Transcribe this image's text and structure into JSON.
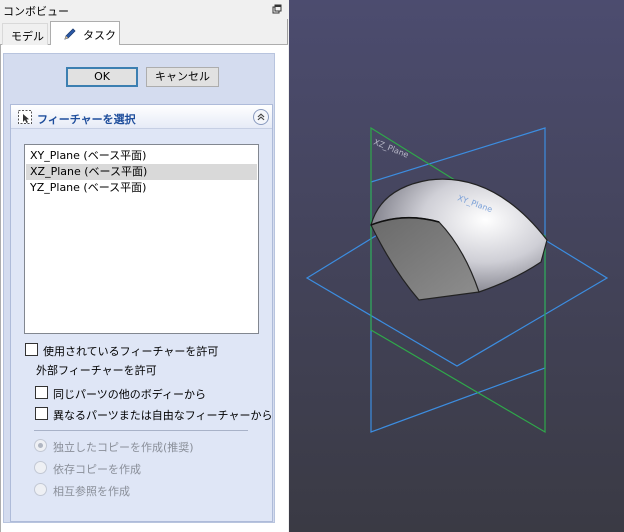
{
  "panel": {
    "title": "コンボビュー",
    "tabs": [
      {
        "label": "モデル"
      },
      {
        "label": "タスク"
      }
    ]
  },
  "dialog": {
    "ok_label": "OK",
    "cancel_label": "キャンセル"
  },
  "feature_group": {
    "title": "フィーチャーを選択",
    "items": [
      {
        "label": "XY_Plane (ベース平面)",
        "selected": false
      },
      {
        "label": "XZ_Plane (ベース平面)",
        "selected": true
      },
      {
        "label": "YZ_Plane (ベース平面)",
        "selected": false
      }
    ],
    "allow_used_label": "使用されているフィーチャーを許可",
    "external_title": "外部フィーチャーを許可",
    "same_part_label": "同じパーツの他のボディーから",
    "other_part_label": "異なるパーツまたは自由なフィーチャーから",
    "radio_options": [
      {
        "label": "独立したコピーを作成(推奨)",
        "checked": true
      },
      {
        "label": "依存コピーを作成",
        "checked": false
      },
      {
        "label": "相互参照を作成",
        "checked": false
      }
    ]
  },
  "viewport": {
    "plane_labels": [
      "XZ_Plane",
      "XY_Plane"
    ],
    "colors": {
      "background_top": "#4c4c6f",
      "background_bottom": "#3a3a44",
      "plane_blue": "#3c8de0",
      "plane_green": "#2fa84a",
      "accent": "#3c7fb1",
      "group_title": "#1f4e9c"
    }
  }
}
